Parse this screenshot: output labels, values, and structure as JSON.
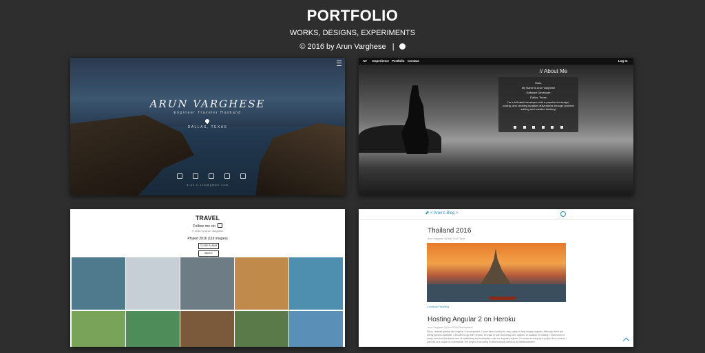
{
  "header": {
    "title": "PORTFOLIO",
    "subtitle": "WORKS, DESIGNS, EXPERIMENTS",
    "credit": "© 2016 by Arun Varghese",
    "separator": "|",
    "github_icon": "github-icon"
  },
  "cards": {
    "profile": {
      "name": "ARUN VARGHESE",
      "tagline": "Engineer  Traveler  Husband",
      "location": "DALLAS, TEXAS",
      "email": "arun.v.123@gmail.com",
      "menu_icon": "hamburger-icon",
      "social_icons": [
        "linkedin-icon",
        "github-icon",
        "facebook-icon",
        "instagram-icon",
        "rss-icon"
      ]
    },
    "about": {
      "nav_brand": "AV",
      "nav_items": [
        "Experience",
        "Portfolio",
        "Contact"
      ],
      "login": "Log In",
      "heading": "// About Me",
      "greeting": "Hello,",
      "intro": "My Name is Arun Varghese",
      "role": "- Software Developer -",
      "location": "Dallas, Texas",
      "bio": "I'm a full stack developer with a passion for design, coding, and creating tangible deliverables through problem solving and creative thinking!",
      "social_icons": [
        "github-icon",
        "linkedin-icon",
        "facebook-icon",
        "instagram-icon",
        "rss-icon",
        "mail-icon"
      ]
    },
    "travel": {
      "title": "TRAVEL",
      "follow": "Follow me on",
      "credit": "© 2016 by Arun Varghese",
      "album": "Phuket 2016 (119 images)",
      "close_label": "CLOSE ALBUM",
      "about_label": "ABOUT",
      "photo_colors": [
        "#4f7a8e",
        "#c6ced6",
        "#6e7c86",
        "#c08a4a",
        "#4e8fb0",
        "#7aa35a",
        "#4e8c5a",
        "#7a5a3a",
        "#5a7a4a",
        "#5a8fb8"
      ]
    },
    "blog": {
      "brand": "< Arun's Blog >",
      "post1_title": "Thailand 2016",
      "post1_meta": "Arun Varghese   18 Nov 2016   Travel",
      "continue": "Continue Reading",
      "post2_title": "Hosting Angular 2 on Heroku",
      "post2_meta": "Arun Varghese   16 Nov 2016   Development",
      "post2_excerpt": "Since I started getting into Angular 2 development, I have been looking for easy ways to host simple projects. Although there are plenty options available, I decided to go with Heroku, for ease of use and cheap dev options. In addition to hosting, I discovered a pretty neat tool that takes care of scaffolding and boilerplate code for angular projects. To create and deploy a project from scratch I just had to a couple of commands! The project I am using for this example below is an identicalement."
    }
  }
}
